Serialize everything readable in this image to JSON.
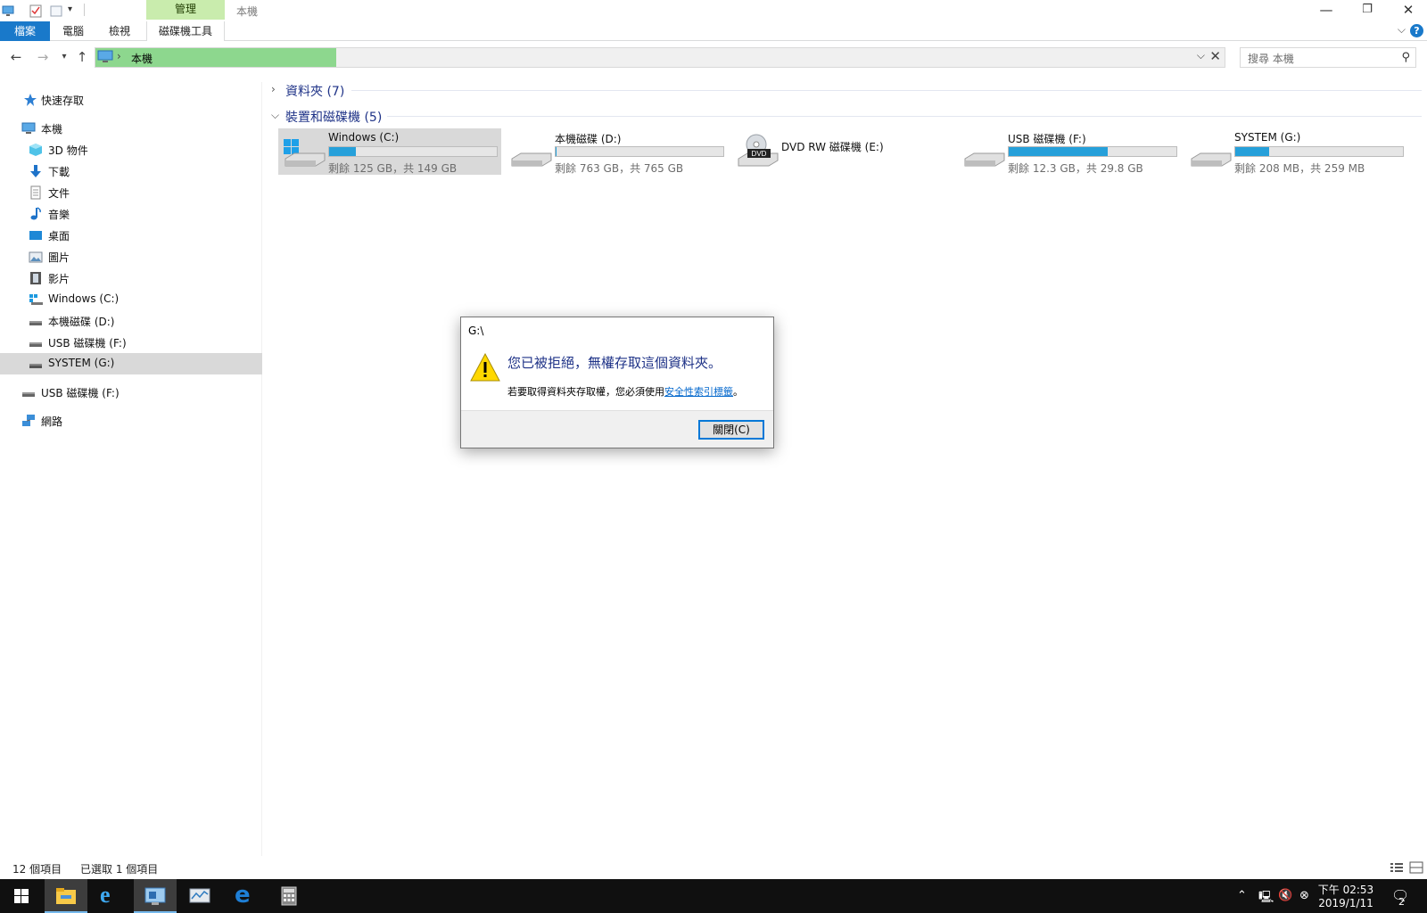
{
  "window": {
    "title": "本機",
    "manage_header": "管理"
  },
  "ribbon": {
    "tabs": [
      {
        "label": "檔案"
      },
      {
        "label": "電腦"
      },
      {
        "label": "檢視"
      },
      {
        "label": "磁碟機工具"
      }
    ],
    "help": "?"
  },
  "address": {
    "path": "本機",
    "search_placeholder": "搜尋 本機"
  },
  "nav": {
    "quick_access": "快速存取",
    "this_pc": "本機",
    "items": [
      {
        "label": "3D 物件",
        "icon": "cube-3d-icon"
      },
      {
        "label": "下載",
        "icon": "download-arrow-icon"
      },
      {
        "label": "文件",
        "icon": "document-icon"
      },
      {
        "label": "音樂",
        "icon": "music-note-icon"
      },
      {
        "label": "桌面",
        "icon": "desktop-icon"
      },
      {
        "label": "圖片",
        "icon": "pictures-icon"
      },
      {
        "label": "影片",
        "icon": "video-film-icon"
      },
      {
        "label": "Windows (C:)",
        "icon": "windows-drive-icon"
      },
      {
        "label": "本機磁碟 (D:)",
        "icon": "hard-drive-icon"
      },
      {
        "label": "USB 磁碟機 (F:)",
        "icon": "usb-drive-icon"
      },
      {
        "label": "SYSTEM (G:)",
        "icon": "hard-drive-icon"
      }
    ],
    "usb_root": "USB 磁碟機 (F:)",
    "network": "網路"
  },
  "content": {
    "group_folders": "資料夾 (7)",
    "group_devices": "裝置和磁碟機 (5)",
    "drives": [
      {
        "name": "Windows (C:)",
        "free": "剩餘 125 GB，共 149 GB",
        "used_fraction": 0.16,
        "icon": "windows-drive-icon"
      },
      {
        "name": "本機磁碟 (D:)",
        "free": "剩餘 763 GB，共 765 GB",
        "used_fraction": 0.003,
        "icon": "hard-drive-icon"
      },
      {
        "name": "DVD RW 磁碟機 (E:)",
        "free": "",
        "used_fraction": null,
        "icon": "dvd-drive-icon"
      },
      {
        "name": "USB 磁碟機 (F:)",
        "free": "剩餘 12.3 GB，共 29.8 GB",
        "used_fraction": 0.59,
        "icon": "usb-drive-icon"
      },
      {
        "name": "SYSTEM (G:)",
        "free": "剩餘 208 MB，共 259 MB",
        "used_fraction": 0.2,
        "icon": "hard-drive-icon"
      }
    ]
  },
  "dialog": {
    "title": "G:\\",
    "main": "您已被拒絕，無權存取這個資料夾。",
    "sub_before": "若要取得資料夾存取權，您必須使用",
    "sub_link": "安全性索引標籤",
    "sub_after": "。",
    "close_button": "關閉(C)"
  },
  "status": {
    "count": "12 個項目",
    "selected": "已選取 1 個項目"
  },
  "taskbar": {
    "time": "下午 02:53",
    "date": "2019/1/11",
    "notifications": "2"
  },
  "colors": {
    "accent": "#1979ca",
    "manage_tab": "#c9ecad",
    "address_progress": "#8dd78e",
    "drive_fill": "#26a0da",
    "group_header": "#1e3287"
  }
}
